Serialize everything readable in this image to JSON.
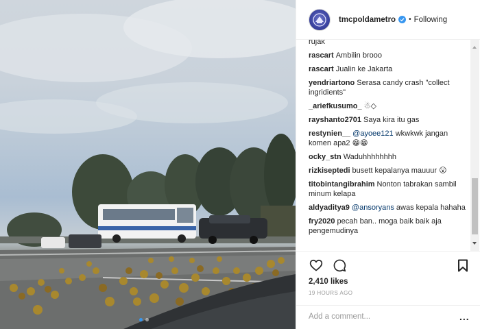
{
  "post": {
    "username": "tmcpoldametro",
    "follow_status": "Following",
    "bullet": "•",
    "likes": "2,410 likes",
    "timestamp": "19 HOURS AGO",
    "comment_placeholder": "Add a comment...",
    "more": "..."
  },
  "comments": [
    {
      "user": "",
      "text": "rujak"
    },
    {
      "user": "rascart",
      "text": "Ambilin brooo"
    },
    {
      "user": "rascart",
      "text": "Jualin ke Jakarta"
    },
    {
      "user": "yendriartono",
      "text": "Serasa candy crash \"collect ingridients\""
    },
    {
      "user": "_ariefkusumo_",
      "text": "☃◇"
    },
    {
      "user": "rayshanto2701",
      "text": "Saya kira itu gas"
    },
    {
      "user": "restynien__",
      "mention": "@ayoee121",
      "text": "wkwkwk jangan komen apa2 😁😁"
    },
    {
      "user": "ocky_stn",
      "text": "Waduhhhhhhhh"
    },
    {
      "user": "rizkiseptedi",
      "text": "busett kepalanya mauuur 😮"
    },
    {
      "user": "titobintangibrahim",
      "text": "Nonton tabrakan sambil minum kelapa"
    },
    {
      "user": "aldyaditya9",
      "mention": "@ansoryans",
      "text": "awas kepala hahaha"
    },
    {
      "user": "fry2020",
      "text": "pecah ban.. moga baik baik aja pengemudinya"
    }
  ],
  "colors": {
    "mention": "#003569",
    "carousel_active": "#3897f0"
  }
}
